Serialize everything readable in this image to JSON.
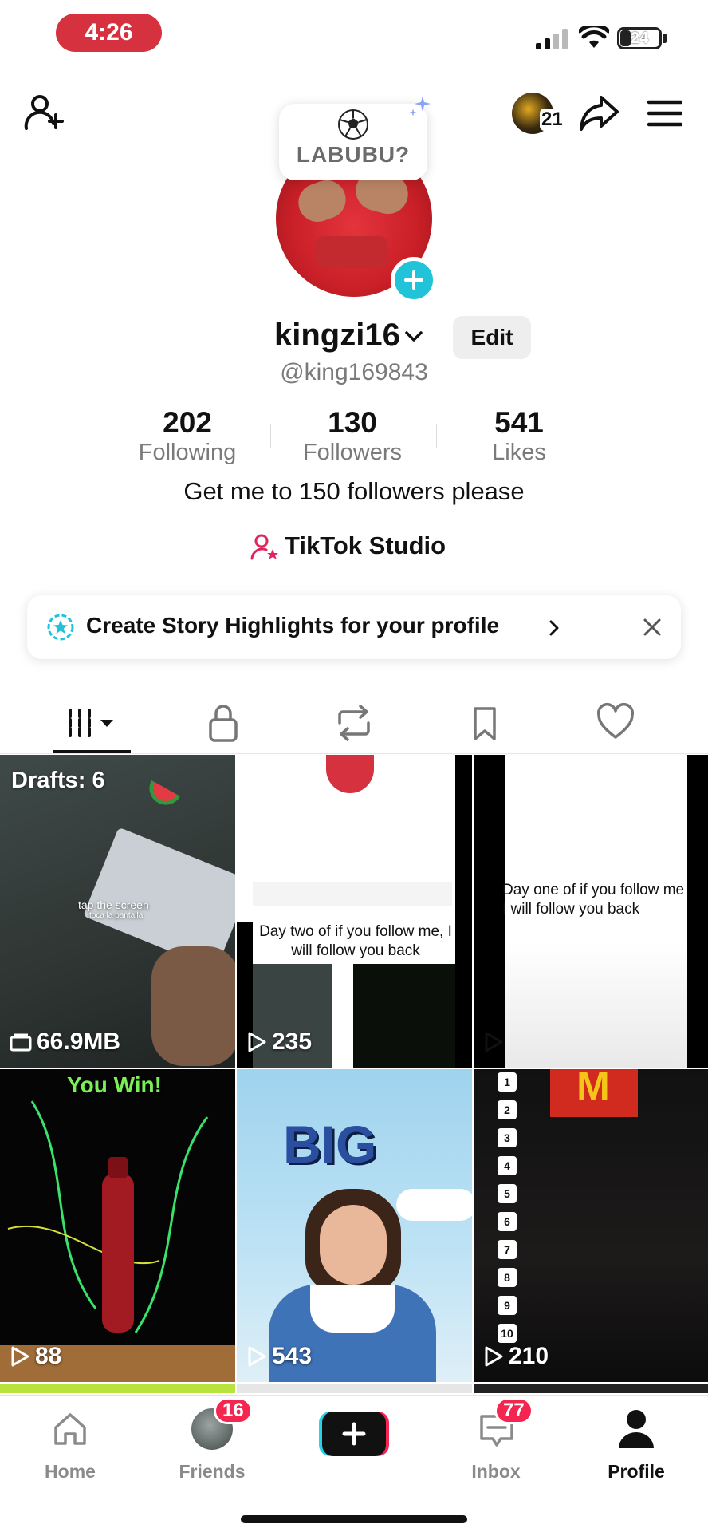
{
  "status_bar": {
    "time": "4:26",
    "battery": "24"
  },
  "top_bar": {
    "avatar_count": "21"
  },
  "profile": {
    "note_text": "LABUBU?",
    "username": "kingzi16",
    "edit_label": "Edit",
    "handle": "@king169843",
    "stats": [
      {
        "value": "202",
        "label": "Following"
      },
      {
        "value": "130",
        "label": "Followers"
      },
      {
        "value": "541",
        "label": "Likes"
      }
    ],
    "bio": "Get me to 150 followers please",
    "studio_label": "TikTok Studio"
  },
  "banner": {
    "text": "Create Story Highlights for your profile"
  },
  "grid": {
    "drafts_label": "Drafts: 6",
    "drafts_tap_text": "tap the screen",
    "drafts_tap_sub": "toca la pantalla",
    "drafts_size": "66.9MB",
    "video2_caption": "Day two of if you follow me, I will follow you back",
    "video2_views": "235",
    "video3_caption": "Day one of if you follow me I will follow you back",
    "video4_caption": "You Win!",
    "video4_views": "88",
    "video5_caption": "BIG",
    "video5_views": "543",
    "video6_numbers": [
      "1",
      "2",
      "3",
      "4",
      "5",
      "6",
      "7",
      "8",
      "9",
      "10"
    ],
    "video6_views": "210"
  },
  "nav": {
    "home": "Home",
    "friends": "Friends",
    "friends_badge": "16",
    "inbox": "Inbox",
    "inbox_badge": "77",
    "profile": "Profile"
  },
  "colors": {
    "time_pill": "#d6313f",
    "accent_cyan": "#20c3d8",
    "badge_red": "#f4254f",
    "studio_pink": "#e0245e"
  }
}
